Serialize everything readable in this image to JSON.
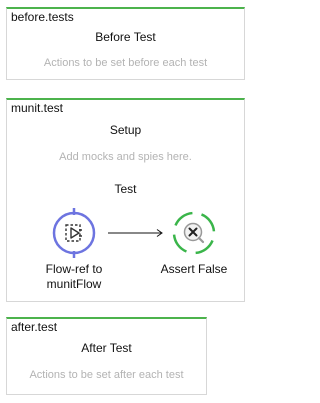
{
  "before_panel": {
    "title": "before.tests",
    "heading": "Before Test",
    "hint": "Actions to be set before each test"
  },
  "munit_panel": {
    "title": "munit.test",
    "setup_heading": "Setup",
    "setup_hint": "Add mocks and spies here.",
    "test_heading": "Test",
    "components": [
      {
        "label_line1": "Flow-ref to",
        "label_line2": "munitFlow",
        "icon": "flow-reference-icon",
        "ring_color": "#6d74e0"
      },
      {
        "label_line1": "Assert False",
        "icon": "assert-false-icon",
        "ring_color": "#3ab54a"
      }
    ]
  },
  "after_panel": {
    "title": "after.test",
    "heading": "After Test",
    "hint": "Actions to be set after each test"
  },
  "colors": {
    "panel_accent": "#4cb34c",
    "hint_text": "#b3b3b3"
  }
}
